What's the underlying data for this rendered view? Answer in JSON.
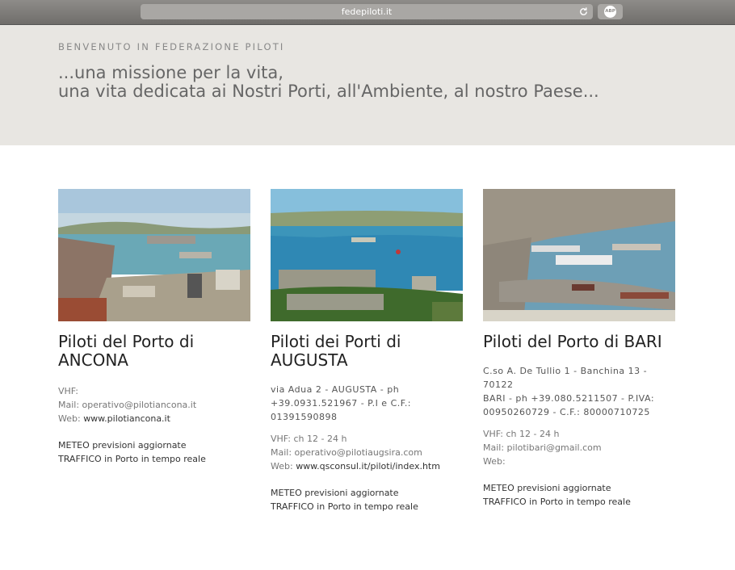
{
  "browser": {
    "url": "fedepiloti.it",
    "extension_label": "ABP"
  },
  "hero": {
    "welcome": "BENVENUTO IN FEDERAZIONE PILOTI",
    "tagline_line1": "...una missione per la vita,",
    "tagline_line2": "una vita dedicata ai Nostri Porti, all'Ambiente, al nostro Paese..."
  },
  "cards": [
    {
      "title_line1": "Piloti del Porto di",
      "title_line2": "ANCONA",
      "vhf": "VHF:",
      "mail_label": "Mail: ",
      "mail": "operativo@pilotiancona.it",
      "web_label": "Web: ",
      "web": "www.pilotiancona.it",
      "meteo": "METEO previsioni aggiornate",
      "traffico": "TRAFFICO in Porto in tempo reale"
    },
    {
      "title_line1": "Piloti dei Porti di",
      "title_line2": "AUGUSTA",
      "address_line1": "via Adua 2 - AUGUSTA - ph",
      "address_line2": "+39.0931.521967 - P.I e C.F.:",
      "address_line3": "01391590898",
      "vhf": "VHF: ch 12 - 24 h",
      "mail_label": "Mail: ",
      "mail": "operativo@pilotiaugsira.com",
      "web_label": "Web: ",
      "web": "www.qsconsul.it/piloti/index.htm",
      "meteo": "METEO previsioni aggiornate",
      "traffico": "TRAFFICO in Porto in tempo reale"
    },
    {
      "title_line1": "Piloti del Porto di BARI",
      "address_line1": "C.so A. De Tullio 1 - Banchina 13 - 70122",
      "address_line2": "BARI - ph +39.080.5211507 - P.IVA:",
      "address_line3": "00950260729 - C.F.: 80000710725",
      "vhf": "VHF: ch 12 - 24 h",
      "mail_label": "Mail: ",
      "mail": "pilotibari@gmail.com",
      "web_label": "Web:",
      "meteo": "METEO previsioni aggiornate",
      "traffico": "TRAFFICO in Porto in tempo reale"
    }
  ]
}
